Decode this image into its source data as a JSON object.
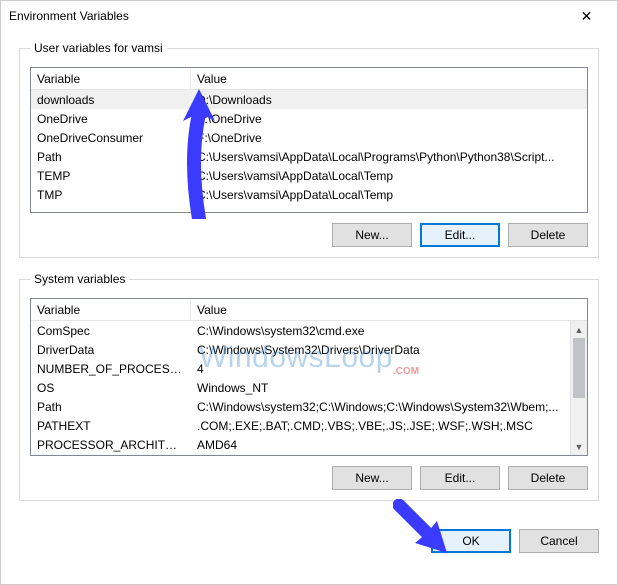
{
  "window": {
    "title": "Environment Variables",
    "close_symbol": "✕"
  },
  "user_section": {
    "legend": "User variables for vamsi",
    "headers": {
      "var": "Variable",
      "val": "Value"
    },
    "rows": [
      {
        "name": "downloads",
        "value": "D:\\Downloads",
        "selected": true
      },
      {
        "name": "OneDrive",
        "value": "F:\\OneDrive"
      },
      {
        "name": "OneDriveConsumer",
        "value": "F:\\OneDrive"
      },
      {
        "name": "Path",
        "value": "C:\\Users\\vamsi\\AppData\\Local\\Programs\\Python\\Python38\\Script..."
      },
      {
        "name": "TEMP",
        "value": "C:\\Users\\vamsi\\AppData\\Local\\Temp"
      },
      {
        "name": "TMP",
        "value": "C:\\Users\\vamsi\\AppData\\Local\\Temp"
      }
    ],
    "buttons": {
      "new": "New...",
      "edit": "Edit...",
      "delete": "Delete"
    },
    "edit_focused": true
  },
  "system_section": {
    "legend": "System variables",
    "headers": {
      "var": "Variable",
      "val": "Value"
    },
    "rows": [
      {
        "name": "ComSpec",
        "value": "C:\\Windows\\system32\\cmd.exe"
      },
      {
        "name": "DriverData",
        "value": "C:\\Windows\\System32\\Drivers\\DriverData"
      },
      {
        "name": "NUMBER_OF_PROCESSORS",
        "value": "4"
      },
      {
        "name": "OS",
        "value": "Windows_NT"
      },
      {
        "name": "Path",
        "value": "C:\\Windows\\system32;C:\\Windows;C:\\Windows\\System32\\Wbem;..."
      },
      {
        "name": "PATHEXT",
        "value": ".COM;.EXE;.BAT;.CMD;.VBS;.VBE;.JS;.JSE;.WSF;.WSH;.MSC"
      },
      {
        "name": "PROCESSOR_ARCHITECTURE",
        "value": "AMD64"
      }
    ],
    "buttons": {
      "new": "New...",
      "edit": "Edit...",
      "delete": "Delete"
    },
    "scrollbar": true
  },
  "dialog_buttons": {
    "ok": "OK",
    "cancel": "Cancel",
    "ok_focused": true
  },
  "watermark": {
    "text": "WindowsLoop",
    "suffix": ".COM"
  },
  "colors": {
    "arrow": "#3b3bff"
  }
}
